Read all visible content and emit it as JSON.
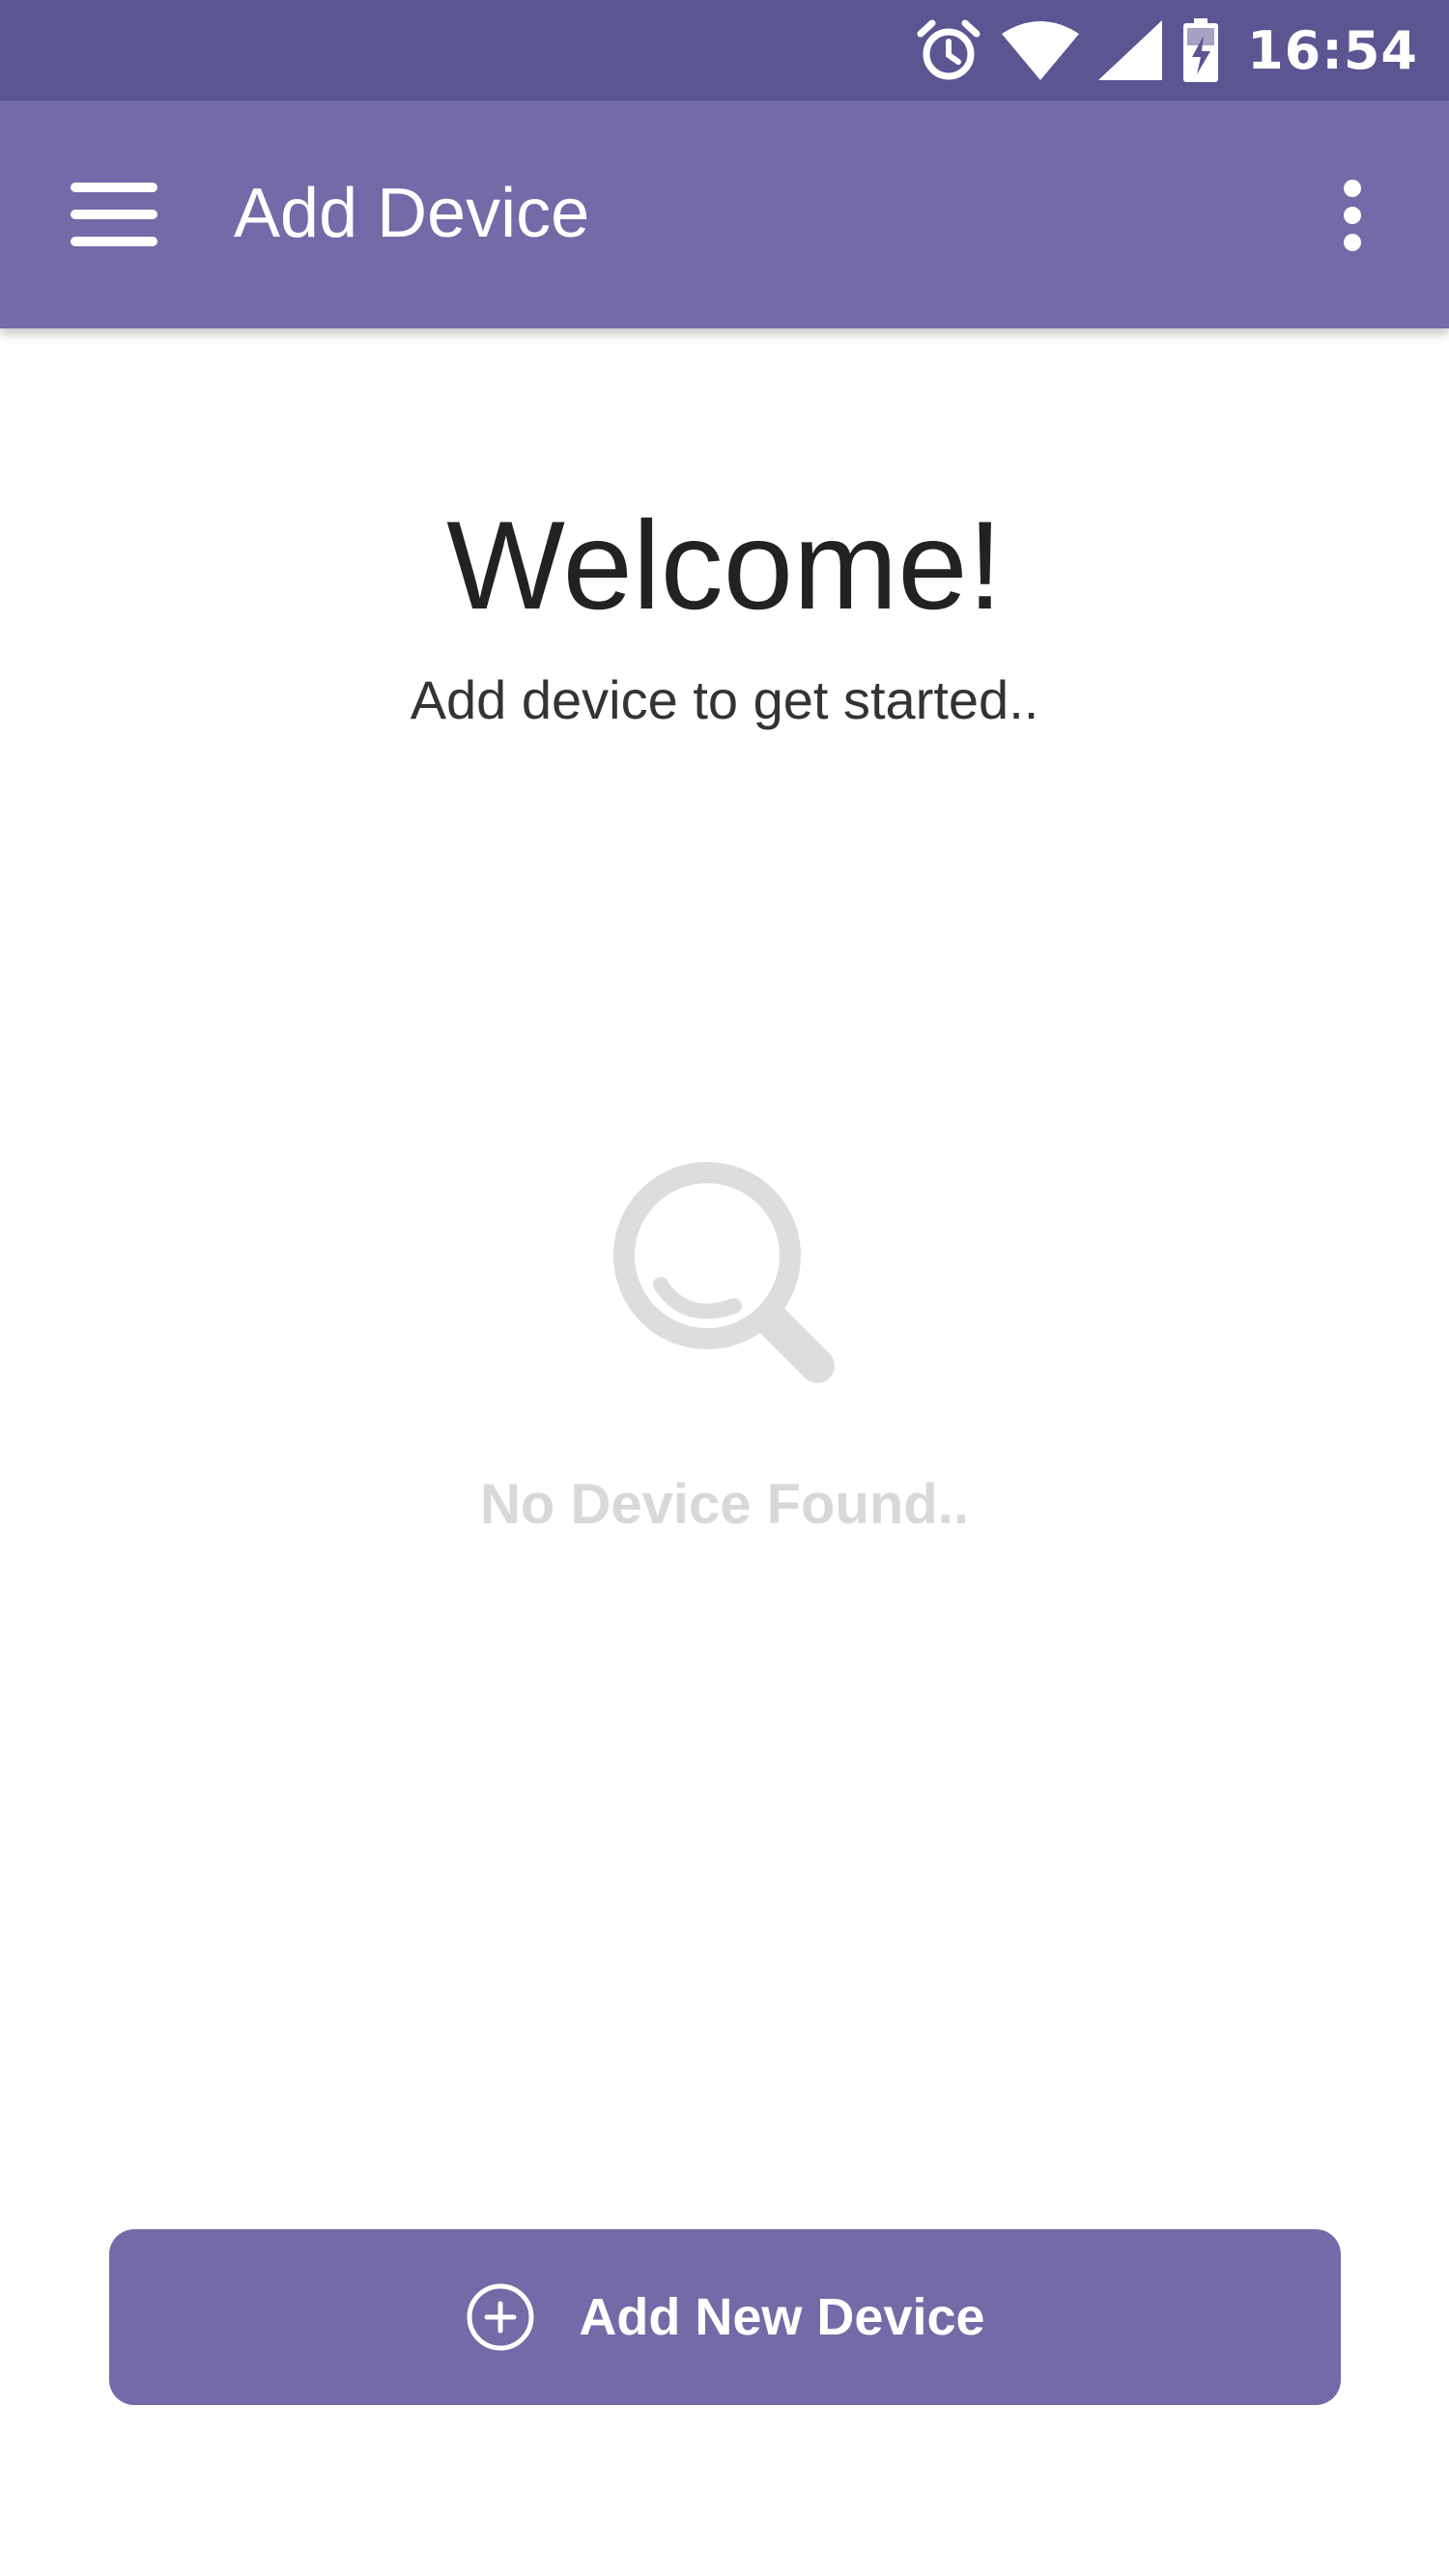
{
  "status_bar": {
    "time": "16:54",
    "icons": [
      "alarm-icon",
      "wifi-icon",
      "cell-signal-icon",
      "battery-charging-icon"
    ]
  },
  "app_bar": {
    "title": "Add Device",
    "menu_icon": "hamburger-menu-icon",
    "overflow_icon": "more-vert-icon"
  },
  "main": {
    "welcome_title": "Welcome!",
    "welcome_subtitle": "Add device to get started..",
    "empty_state": {
      "icon": "search-icon",
      "text": "No Device Found.."
    }
  },
  "actions": {
    "add_button_icon": "add-circle-icon",
    "add_button_label": "Add New Device"
  },
  "colors": {
    "status_bar": "#5b5592",
    "primary": "#726ba7",
    "empty_state": "#d8d8d8"
  }
}
